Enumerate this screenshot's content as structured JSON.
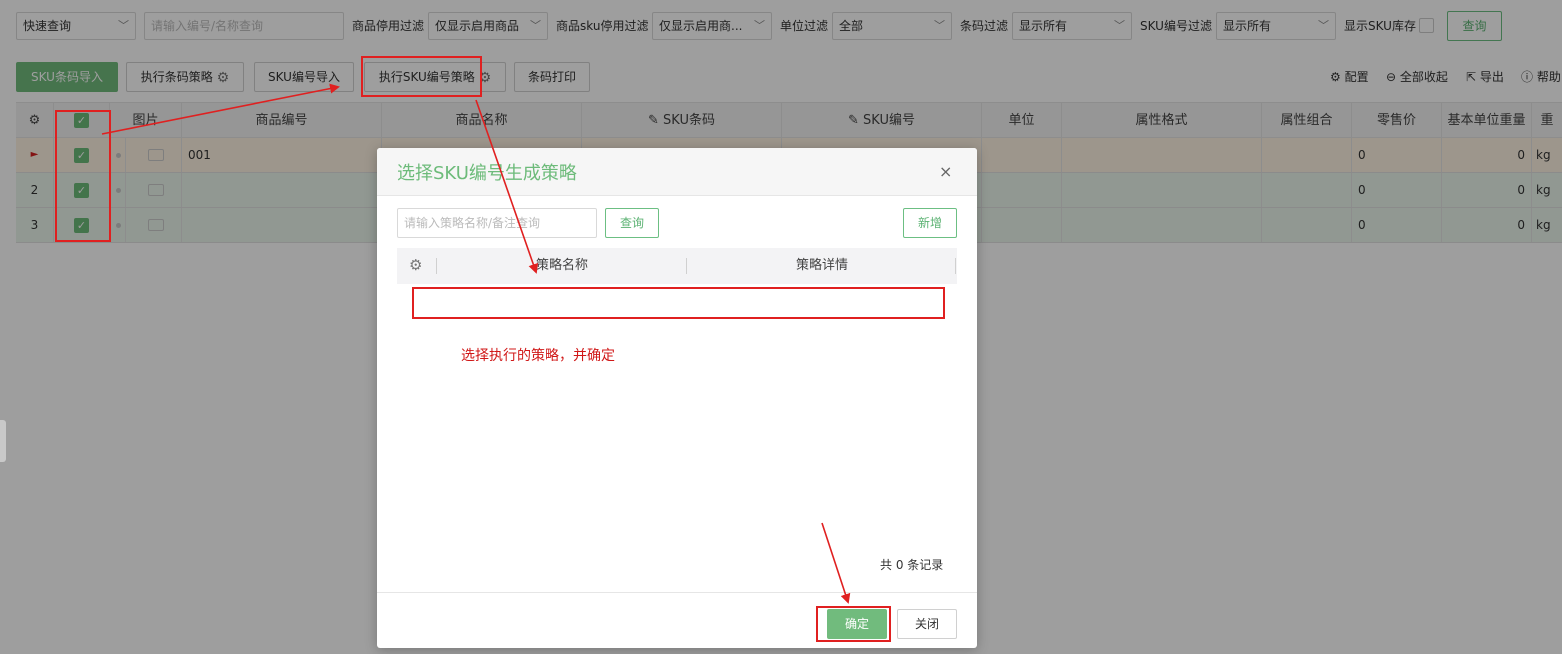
{
  "filters": {
    "quick_query": "快速查询",
    "search_placeholder": "请输入编号/名称查询",
    "goods_disable_label": "商品停用过滤",
    "goods_disable_value": "仅显示启用商品",
    "sku_disable_label": "商品sku停用过滤",
    "sku_disable_value": "仅显示启用商...",
    "unit_label": "单位过滤",
    "unit_value": "全部",
    "barcode_label": "条码过滤",
    "barcode_value": "显示所有",
    "sku_code_label": "SKU编号过滤",
    "sku_code_value": "显示所有",
    "show_stock_label": "显示SKU库存",
    "query_button": "查询"
  },
  "toolbar": {
    "sku_barcode_import": "SKU条码导入",
    "exec_barcode_strategy": "执行条码策略",
    "sku_code_import": "SKU编号导入",
    "exec_sku_code_strategy": "执行SKU编号策略",
    "barcode_print": "条码打印",
    "config": "配置",
    "collapse_all": "全部收起",
    "export": "导出",
    "help": "帮助"
  },
  "grid": {
    "columns": [
      "图片",
      "商品编号",
      "商品名称",
      "SKU条码",
      "SKU编号",
      "单位",
      "属性格式",
      "属性组合",
      "零售价",
      "基本单位重量",
      "重"
    ],
    "rows": [
      {
        "index": "►",
        "code": "001",
        "retail": "0",
        "weight": "0",
        "unit": "kg"
      },
      {
        "index": "2",
        "code": "",
        "retail": "0",
        "weight": "0",
        "unit": "kg"
      },
      {
        "index": "3",
        "code": "",
        "retail": "0",
        "weight": "0",
        "unit": "kg"
      }
    ]
  },
  "modal": {
    "title": "选择SKU编号生成策略",
    "close": "×",
    "search_placeholder": "请输入策略名称/备注查询",
    "query_button": "查询",
    "add_button": "新增",
    "col_name": "策略名称",
    "col_detail": "策略详情",
    "record_count": "共 0 条记录",
    "confirm_button": "确定",
    "close_button": "关闭"
  },
  "annotation": {
    "note": "选择执行的策略，并确定"
  },
  "colors": {
    "brand_green": "#6dbb7a",
    "annotation_red": "#e02020",
    "row_selected": "#fdf3e3",
    "row_green": "#eaf5ec"
  }
}
